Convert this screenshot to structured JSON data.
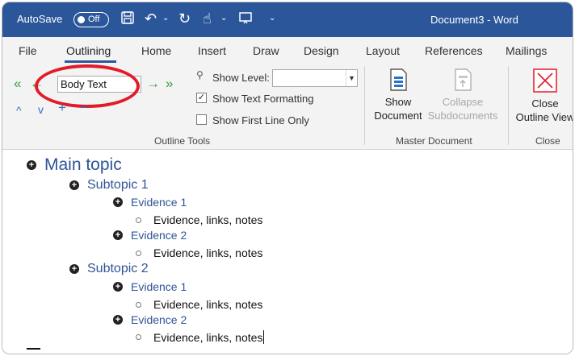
{
  "titlebar": {
    "autosave_label": "AutoSave",
    "toggle_label": "Off",
    "document_title": "Document3  -  Word",
    "accent_color": "#2b579a"
  },
  "tabs": [
    {
      "label": "File"
    },
    {
      "label": "Outlining",
      "active": true
    },
    {
      "label": "Home"
    },
    {
      "label": "Insert"
    },
    {
      "label": "Draw"
    },
    {
      "label": "Design"
    },
    {
      "label": "Layout"
    },
    {
      "label": "References"
    },
    {
      "label": "Mailings"
    }
  ],
  "ribbon": {
    "outline_tools": {
      "level_value": "Body Text",
      "show_level_label": "Show Level:",
      "show_level_value": "",
      "show_text_formatting_label": "Show Text Formatting",
      "show_text_formatting_checked": true,
      "show_first_line_only_label": "Show First Line Only",
      "show_first_line_only_checked": false,
      "group_label": "Outline Tools"
    },
    "master_document": {
      "show_document_label_1": "Show",
      "show_document_label_2": "Document",
      "collapse_label_1": "Collapse",
      "collapse_label_2": "Subdocuments",
      "group_label": "Master Document"
    },
    "close": {
      "close_label_1": "Close",
      "close_label_2": "Outline View",
      "group_label": "Close"
    }
  },
  "outline": {
    "main_topic": "Main topic",
    "subtopic_1": "Subtopic 1",
    "s1_evidence_1": "Evidence 1",
    "s1_e1_notes": "Evidence, links, notes",
    "s1_evidence_2": "Evidence 2",
    "s1_e2_notes": "Evidence, links, notes",
    "subtopic_2": "Subtopic 2",
    "s2_evidence_1": "Evidence 1",
    "s2_e1_notes": "Evidence, links, notes",
    "s2_evidence_2": "Evidence 2",
    "s2_e2_notes": "Evidence, links, notes"
  }
}
